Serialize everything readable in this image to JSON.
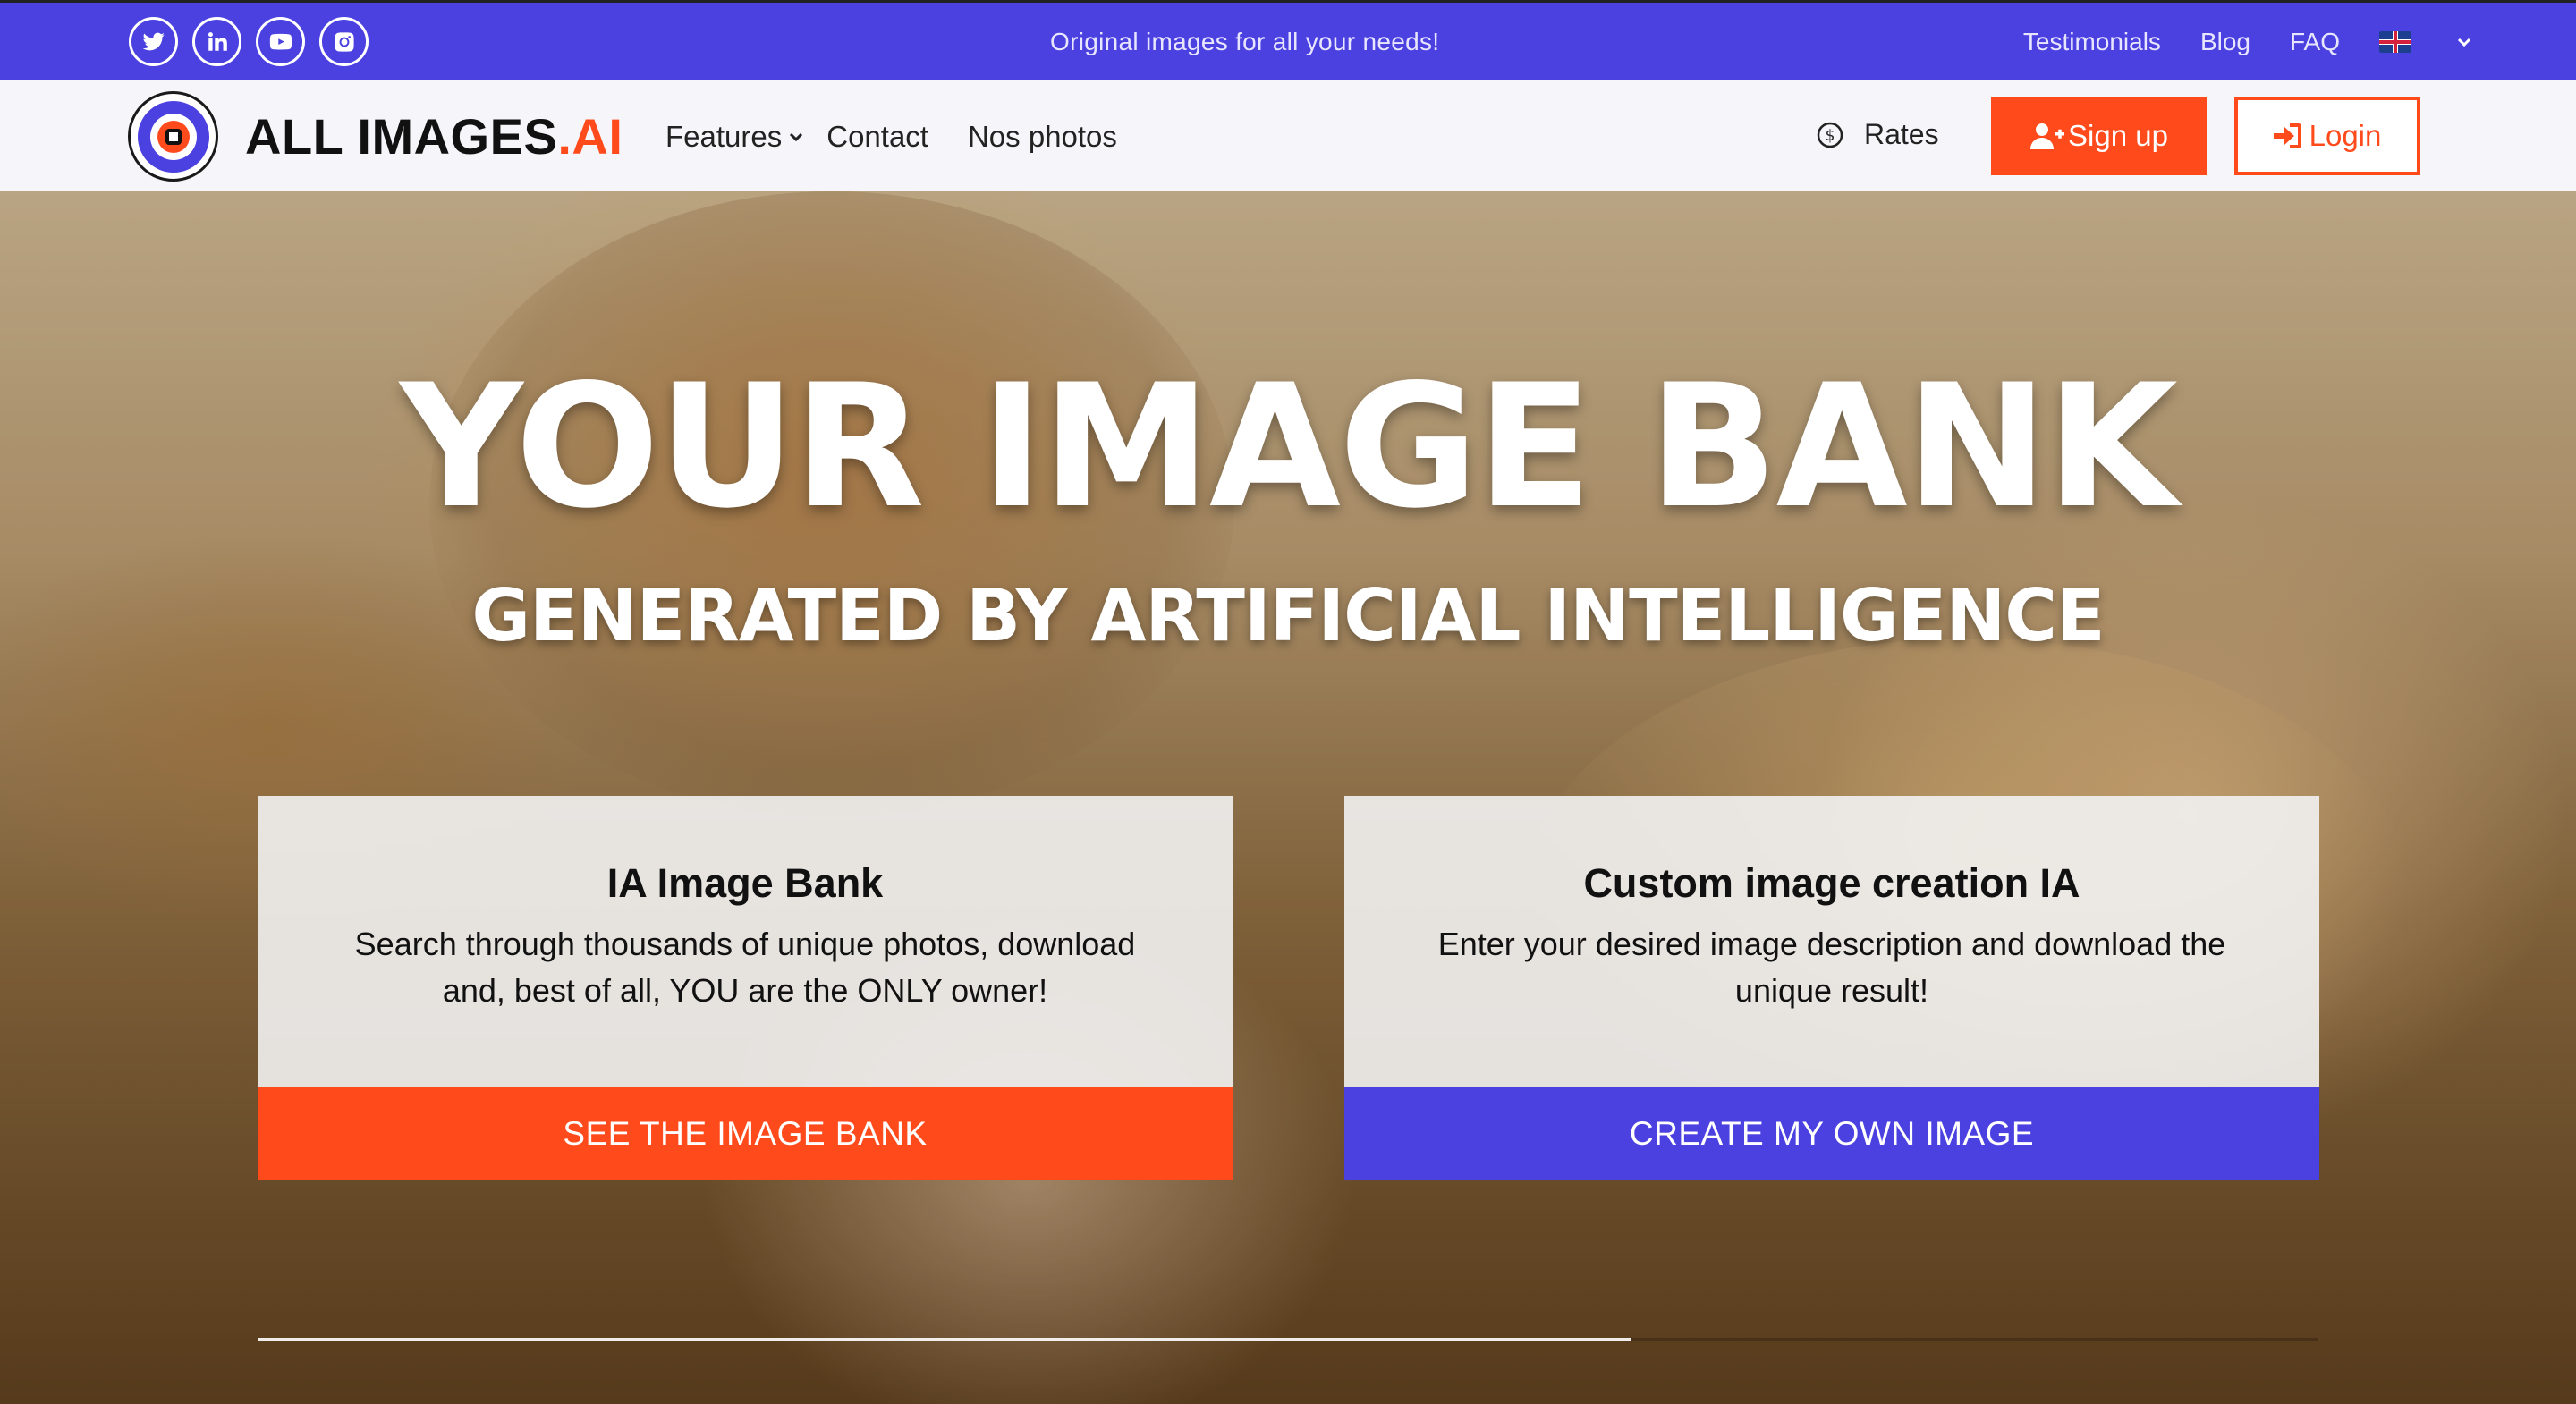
{
  "topbar": {
    "socials": [
      "twitter-icon",
      "linkedin-icon",
      "youtube-icon",
      "instagram-icon"
    ],
    "tagline": "Original images for all your needs!",
    "links": [
      "Testimonials",
      "Blog",
      "FAQ"
    ],
    "language_flag": "uk-flag-icon"
  },
  "navbar": {
    "brand_main": "ALL IMAGES",
    "brand_accent": ".AI",
    "links": {
      "features": "Features",
      "contact": "Contact",
      "photos": "Nos photos"
    },
    "rates": "Rates",
    "signup": "Sign up",
    "login": "Login"
  },
  "hero": {
    "title": "YOUR IMAGE BANK",
    "subtitle": "GENERATED BY ARTIFICIAL INTELLIGENCE"
  },
  "cards": [
    {
      "title": "IA Image Bank",
      "text": "Search through thousands of unique photos, download and, best of all, YOU are the ONLY owner!",
      "button": "SEE THE IMAGE BANK"
    },
    {
      "title": "Custom image creation IA",
      "text": "Enter your desired image description and download the unique result!",
      "button": "CREATE MY OWN IMAGE"
    }
  ],
  "colors": {
    "primary": "#4b40e0",
    "accent": "#ff4a1c"
  }
}
